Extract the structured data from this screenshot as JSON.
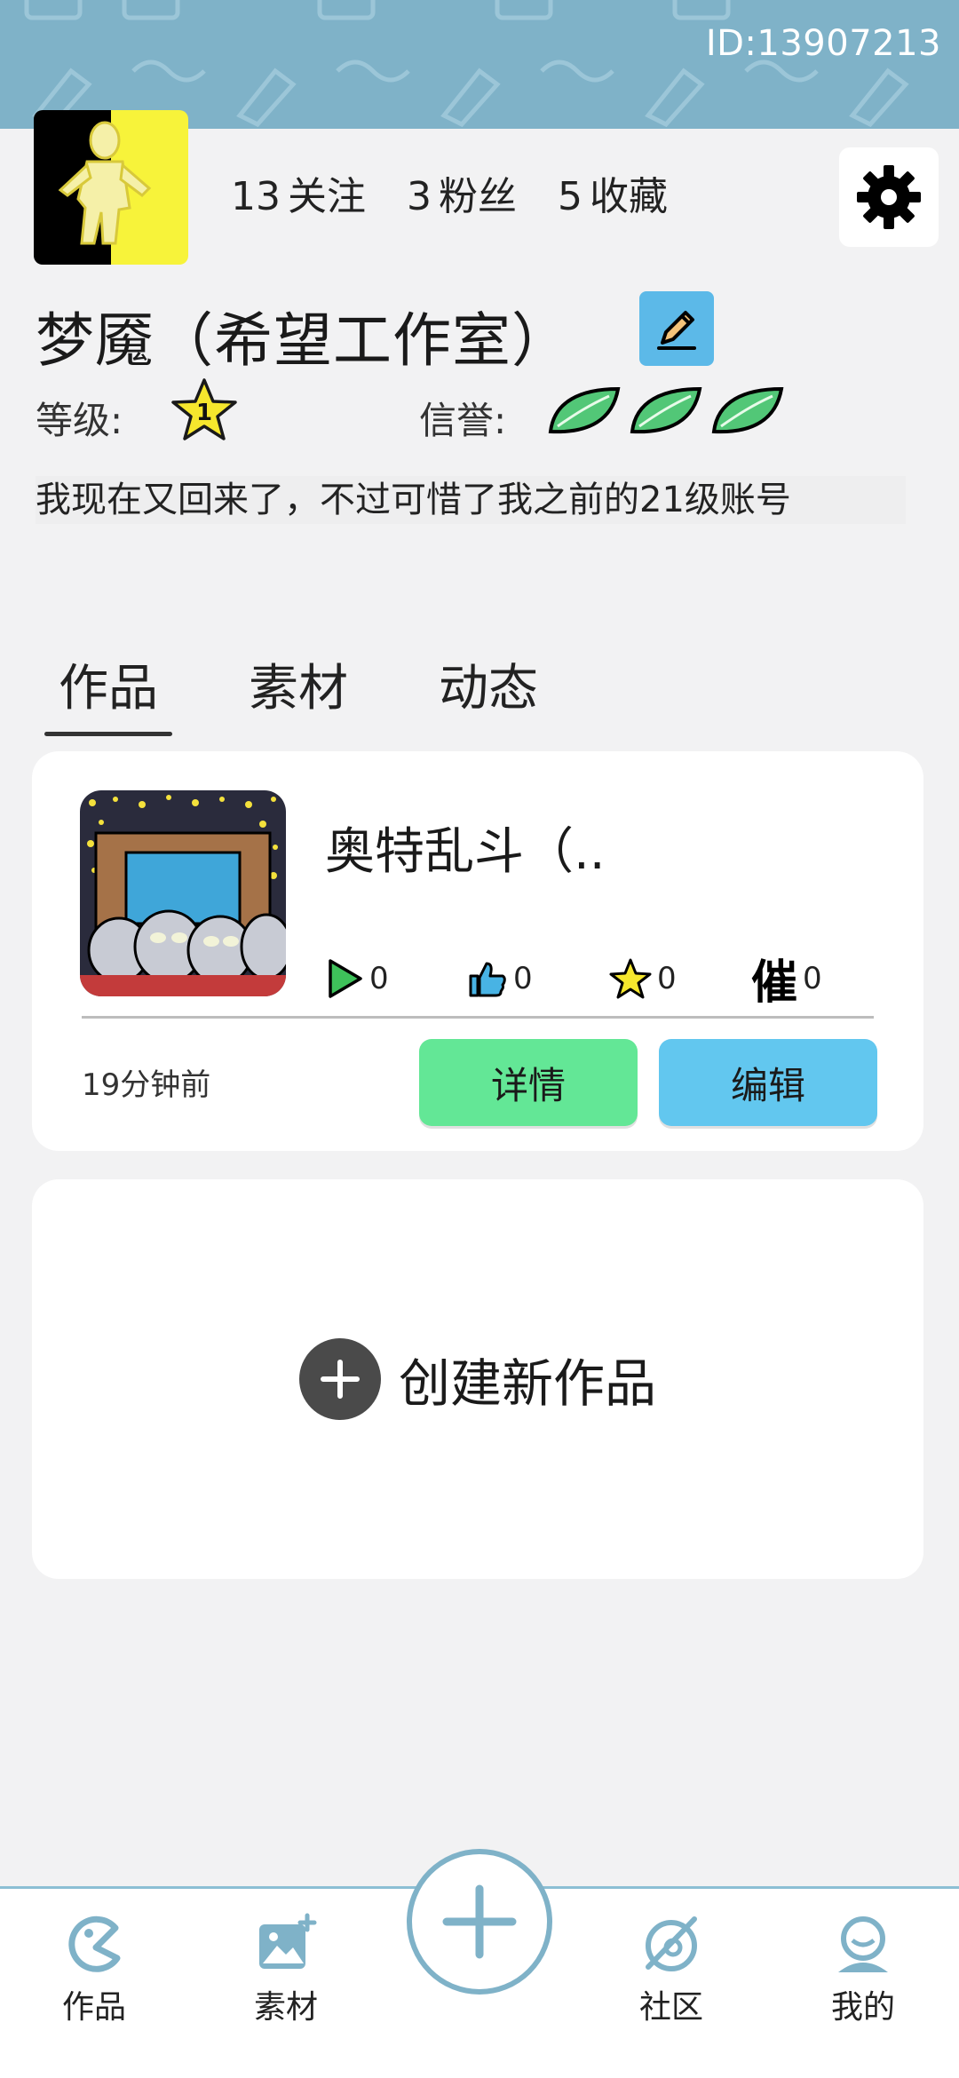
{
  "header": {
    "user_id": "ID:13907213"
  },
  "profile": {
    "following_count": "13",
    "following_label": "关注",
    "fans_count": "3",
    "fans_label": "粉丝",
    "favorites_count": "5",
    "favorites_label": "收藏",
    "username": "梦魇（希望工作室）",
    "level_label": "等级:",
    "level_value": "1",
    "credit_label": "信誉:",
    "credit_leaves": 3,
    "bio": "我现在又回来了，不过可惜了我之前的21级账号"
  },
  "tabs": [
    {
      "label": "作品",
      "active": true
    },
    {
      "label": "素材",
      "active": false
    },
    {
      "label": "动态",
      "active": false
    }
  ],
  "work": {
    "title": "奥特乱斗（..",
    "plays": "0",
    "likes": "0",
    "stars": "0",
    "urge_glyph": "催",
    "urges": "0",
    "time": "19分钟前",
    "detail_label": "详情",
    "edit_label": "编辑"
  },
  "create": {
    "label": "创建新作品"
  },
  "bottom_nav": [
    {
      "label": "作品",
      "icon": "pacman-icon"
    },
    {
      "label": "素材",
      "icon": "image-add-icon"
    },
    {
      "label": "社区",
      "icon": "planet-icon"
    },
    {
      "label": "我的",
      "icon": "profile-icon"
    }
  ],
  "colors": {
    "accent": "#7fb2c8",
    "detail_button": "#63e796",
    "edit_button": "#62c7ef",
    "leaf_green": "#3fb86a"
  }
}
